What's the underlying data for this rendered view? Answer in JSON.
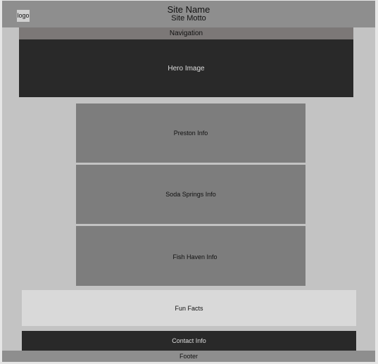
{
  "header": {
    "logo_text": "logo",
    "site_name": "Site Name",
    "site_motto": "Site Motto"
  },
  "nav": {
    "label": "Navigation"
  },
  "hero": {
    "label": "Hero Image"
  },
  "sections": {
    "preston": "Preston Info",
    "soda_springs": "Soda Springs Info",
    "fish_haven": "Fish Haven Info"
  },
  "fun_facts": {
    "label": "Fun Facts"
  },
  "contact": {
    "label": "Contact Info"
  },
  "footer": {
    "label": "Footer"
  },
  "colors": {
    "header_bg": "#8e8e8e",
    "page_bg": "#c3c3c3",
    "nav_bg": "#7c7877",
    "hero_bg": "#292929",
    "info_bg": "#7d7d7d",
    "fun_bg": "#d9d9d9",
    "contact_bg": "#292929"
  }
}
